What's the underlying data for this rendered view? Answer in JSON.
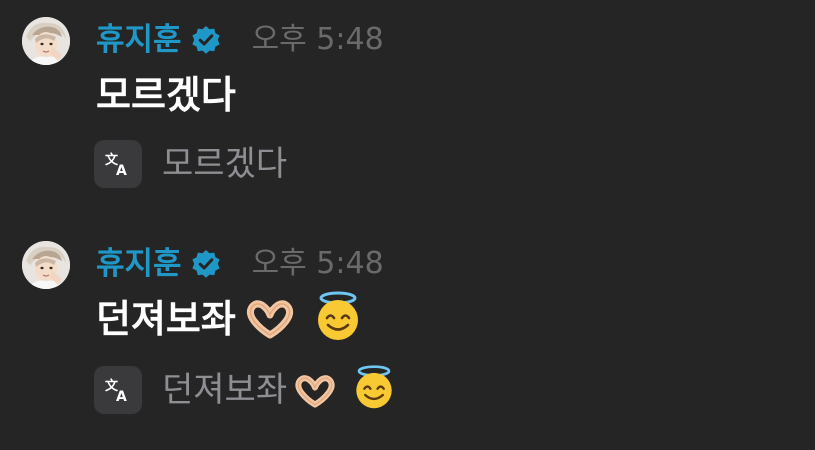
{
  "messages": [
    {
      "author": "휴지훈",
      "verified": true,
      "time": "오후 5:48",
      "text": "모르겠다",
      "translation_icon": "translate-icon",
      "translated_text": "모르겠다"
    },
    {
      "author": "휴지훈",
      "verified": true,
      "time": "오후 5:48",
      "text": "던져보좌",
      "text_emojis": [
        "heart-hands-emoji",
        "smiling-face-with-halo-emoji"
      ],
      "translation_icon": "translate-icon",
      "translated_text": "던져보좌",
      "translated_emojis": [
        "heart-hands-emoji",
        "smiling-face-with-halo-emoji"
      ]
    }
  ],
  "colors": {
    "background": "#252526",
    "author": "#1f98c7",
    "verified_badge": "#1f98c7",
    "timestamp": "#6a6a6c",
    "message_text": "#ffffff",
    "translated_text": "#8e8e93",
    "translate_button": "#3a3a3c"
  }
}
